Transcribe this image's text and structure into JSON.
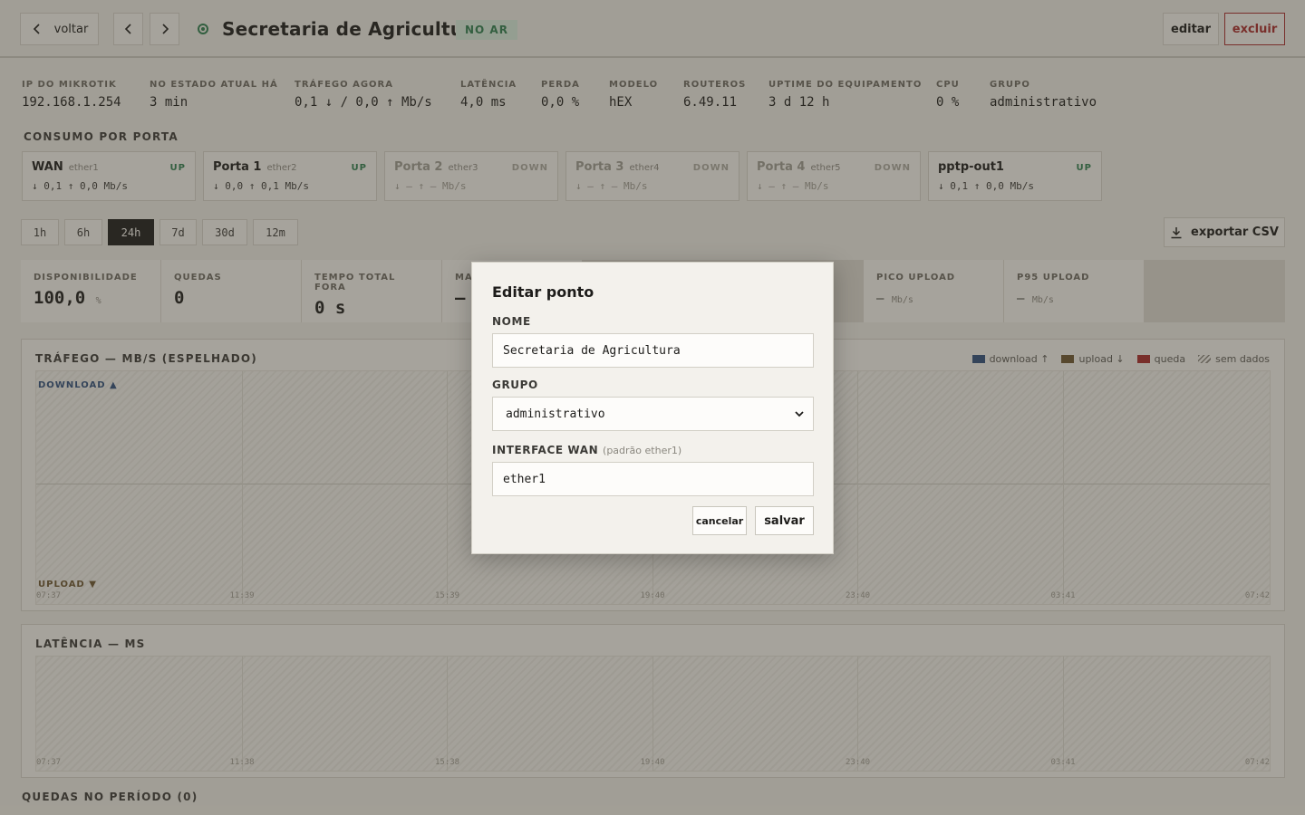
{
  "header": {
    "back_label": "voltar",
    "title": "Secretaria de Agricultura",
    "status_badge": "NO AR",
    "edit_label": "editar",
    "delete_label": "excluir"
  },
  "stats": [
    {
      "key": "IP DO MIKROTIK",
      "value": "192.168.1.254"
    },
    {
      "key": "NO ESTADO ATUAL HÁ",
      "value": "3 min"
    },
    {
      "key": "TRÁFEGO AGORA",
      "value": "0,1 ↓ / 0,0 ↑ Mb/s"
    },
    {
      "key": "LATÊNCIA",
      "value": "4,0 ms"
    },
    {
      "key": "PERDA",
      "value": "0,0 %"
    },
    {
      "key": "MODELO",
      "value": "hEX"
    },
    {
      "key": "ROUTEROS",
      "value": "6.49.11"
    },
    {
      "key": "UPTIME DO EQUIPAMENTO",
      "value": "3 d 12 h"
    },
    {
      "key": "CPU",
      "value": "0 %"
    },
    {
      "key": "GRUPO",
      "value": "administrativo"
    }
  ],
  "ports_title": "CONSUMO POR PORTA",
  "ports": [
    {
      "name": "WAN",
      "iface": "ether1",
      "status": "UP",
      "rate": "↓ 0,1 ↑ 0,0 Mb/s"
    },
    {
      "name": "Porta 1",
      "iface": "ether2",
      "status": "UP",
      "rate": "↓ 0,0 ↑ 0,1 Mb/s"
    },
    {
      "name": "Porta 2",
      "iface": "ether3",
      "status": "DOWN",
      "rate": "↓ — ↑ — Mb/s"
    },
    {
      "name": "Porta 3",
      "iface": "ether4",
      "status": "DOWN",
      "rate": "↓ — ↑ — Mb/s"
    },
    {
      "name": "Porta 4",
      "iface": "ether5",
      "status": "DOWN",
      "rate": "↓ — ↑ — Mb/s"
    },
    {
      "name": "pptp-out1",
      "iface": "",
      "status": "UP",
      "rate": "↓ 0,1 ↑ 0,0 Mb/s"
    }
  ],
  "ranges": [
    "1h",
    "6h",
    "24h",
    "7d",
    "30d",
    "12m"
  ],
  "active_range": "24h",
  "export_label": "exportar CSV",
  "metrics": [
    {
      "key": "DISPONIBILIDADE",
      "value": "100,0",
      "unit": "%"
    },
    {
      "key": "QUEDAS",
      "value": "0",
      "unit": ""
    },
    {
      "key": "TEMPO TOTAL FORA",
      "value": "0 s",
      "unit": ""
    },
    {
      "key": "MA",
      "value": "—",
      "unit": ""
    },
    {
      "key": "PICO UPLOAD",
      "value": "—",
      "unit": "Mb/s"
    },
    {
      "key": "P95 UPLOAD",
      "value": "—",
      "unit": "Mb/s"
    }
  ],
  "traffic_chart": {
    "title": "TRÁFEGO — MB/S (ESPELHADO)",
    "download_label": "DOWNLOAD ▲",
    "upload_label": "UPLOAD ▼",
    "legend": [
      {
        "label": "download ↑",
        "color": "#2f4f7a"
      },
      {
        "label": "upload ↓",
        "color": "#6b5530"
      },
      {
        "label": "queda",
        "color": "#a52a2a"
      },
      {
        "label": "sem dados",
        "color": "hatch"
      }
    ],
    "x_ticks": [
      "07:37",
      "11:39",
      "15:39",
      "19:40",
      "23:40",
      "03:41",
      "07:42"
    ]
  },
  "latency_chart": {
    "title": "LATÊNCIA — MS",
    "x_ticks": [
      "07:37",
      "11:38",
      "15:38",
      "19:40",
      "23:40",
      "03:41",
      "07:42"
    ]
  },
  "drops_title": "QUEDAS NO PERÍODO (0)",
  "modal": {
    "title": "Editar ponto",
    "name_label": "NOME",
    "name_value": "Secretaria de Agricultura",
    "group_label": "GRUPO",
    "group_value": "administrativo",
    "wan_label": "INTERFACE WAN",
    "wan_hint": "(padrão ether1)",
    "wan_value": "ether1",
    "cancel_label": "cancelar",
    "save_label": "salvar"
  },
  "colors": {
    "accent_up": "#2e7d4f",
    "danger": "#a52a2a"
  }
}
